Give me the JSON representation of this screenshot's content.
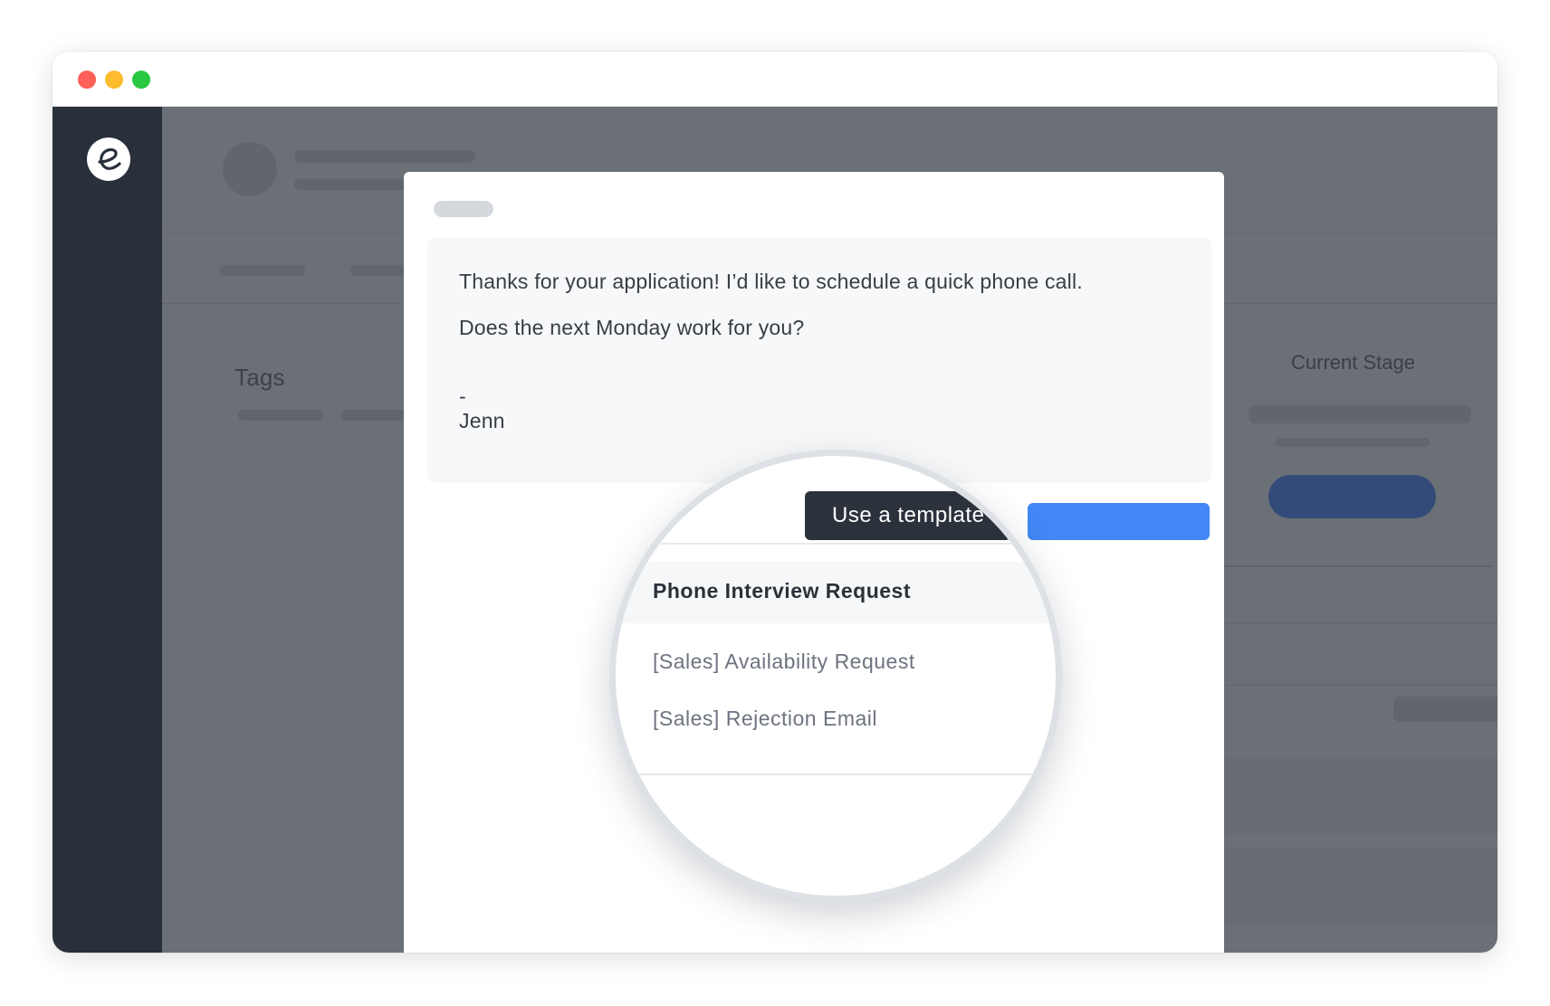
{
  "window": {
    "controls": [
      "close-button",
      "minimize-button",
      "maximize-button"
    ]
  },
  "sidebar": {
    "logo_icon": "e-logo-icon"
  },
  "background": {
    "tags_label": "Tags",
    "current_stage_label": "Current Stage"
  },
  "email": {
    "line1": "Thanks for your application! I’d like to schedule a quick phone call.",
    "line2": "Does the next Monday work for you?",
    "signature_dash": "-",
    "signature_name": "Jenn"
  },
  "template_menu": {
    "tooltip": "Use a template",
    "items": [
      {
        "label": "Phone Interview Request",
        "active": true
      },
      {
        "label": "[Sales] Availability Request",
        "active": false
      },
      {
        "label": "[Sales] Rejection Email",
        "active": false
      }
    ]
  },
  "colors": {
    "sidebar": "#29303b",
    "overlay": "#6b7077",
    "send_button": "#4287f5",
    "stage_button": "#334b78",
    "tooltip": "#2c323c"
  }
}
